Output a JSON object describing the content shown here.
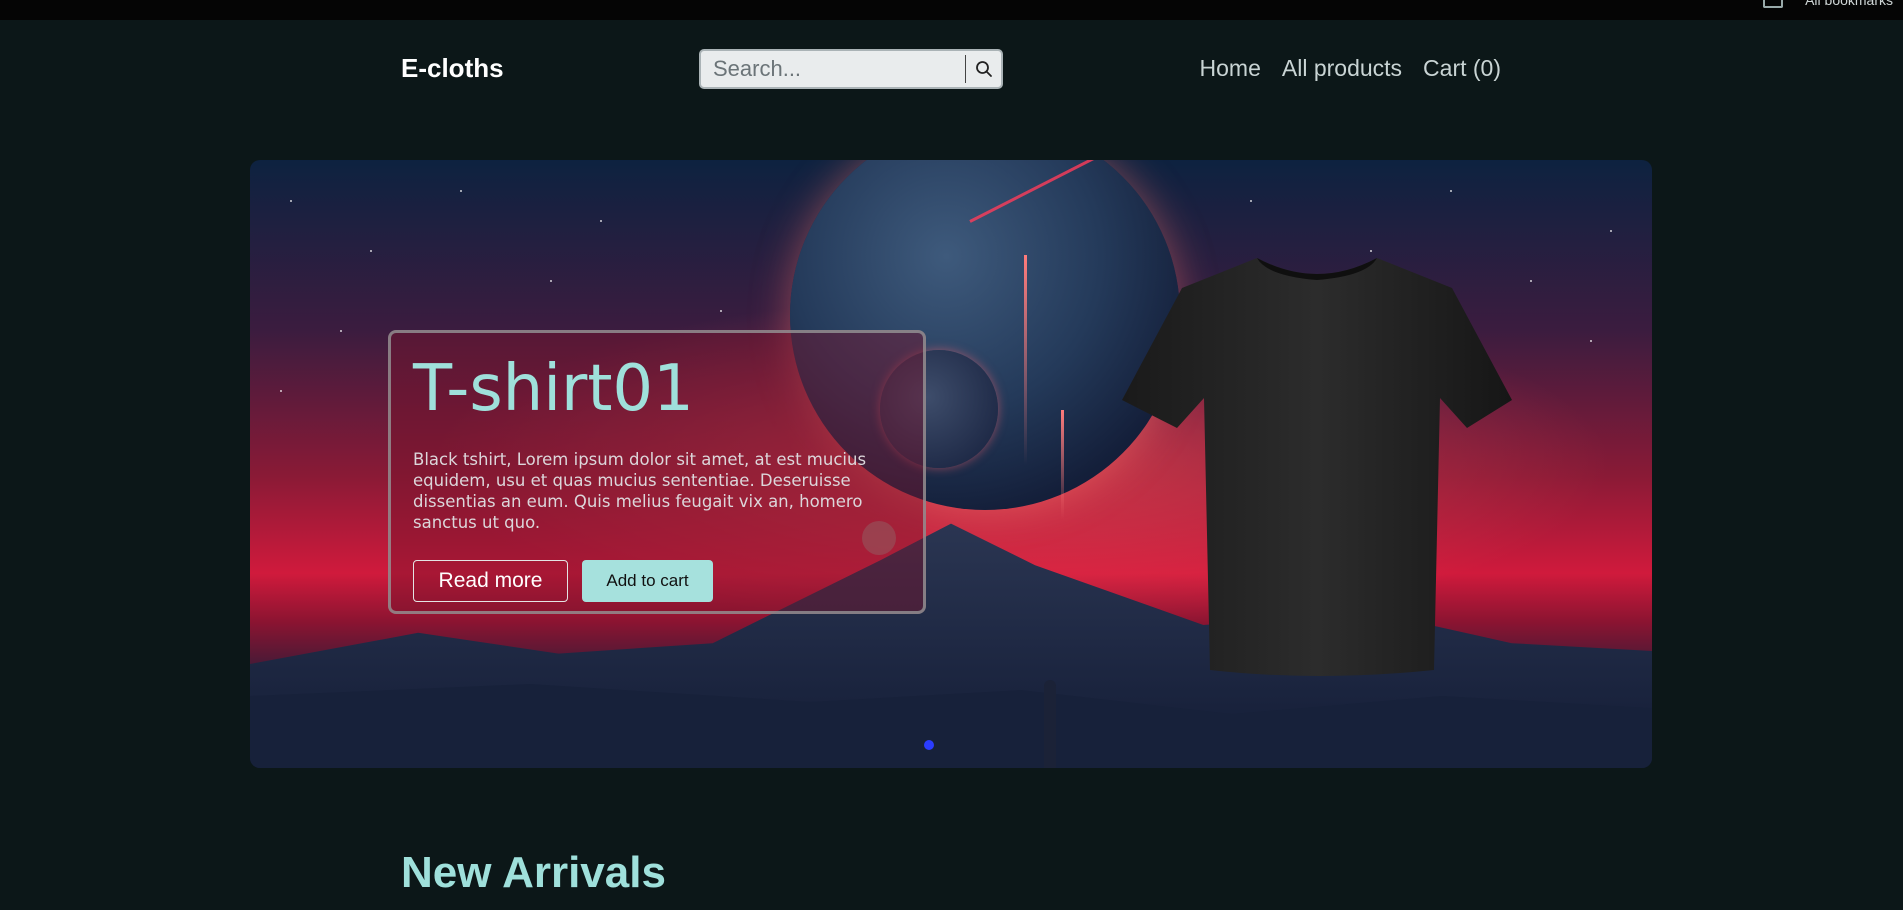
{
  "topbar": {
    "extension_text": "All bookmarks"
  },
  "header": {
    "brand": "E-cloths",
    "search": {
      "placeholder": "Search...",
      "value": ""
    },
    "nav": [
      "Home",
      "All products",
      "Cart (0)"
    ]
  },
  "hero": {
    "title": "T-shirt01",
    "description": "Black tshirt, Lorem ipsum dolor sit amet, at est mucius equidem, usu et quas mucius sententiae. Deseruisse dissentias an eum. Quis melius feugait vix an, homero sanctus ut quo.",
    "read_more_label": "Read more",
    "add_to_cart_label": "Add to cart",
    "slide_indicator": {
      "active": 1,
      "total": 1
    },
    "image_alt": "black t-shirt"
  },
  "sections": {
    "new_arrivals_title": "New Arrivals"
  },
  "colors": {
    "accent": "#a6e1dd",
    "background": "#0c1718",
    "indicator": "#2b3cff"
  },
  "icons": {
    "search": "search-icon",
    "bookmark": "bookmark-icon"
  }
}
